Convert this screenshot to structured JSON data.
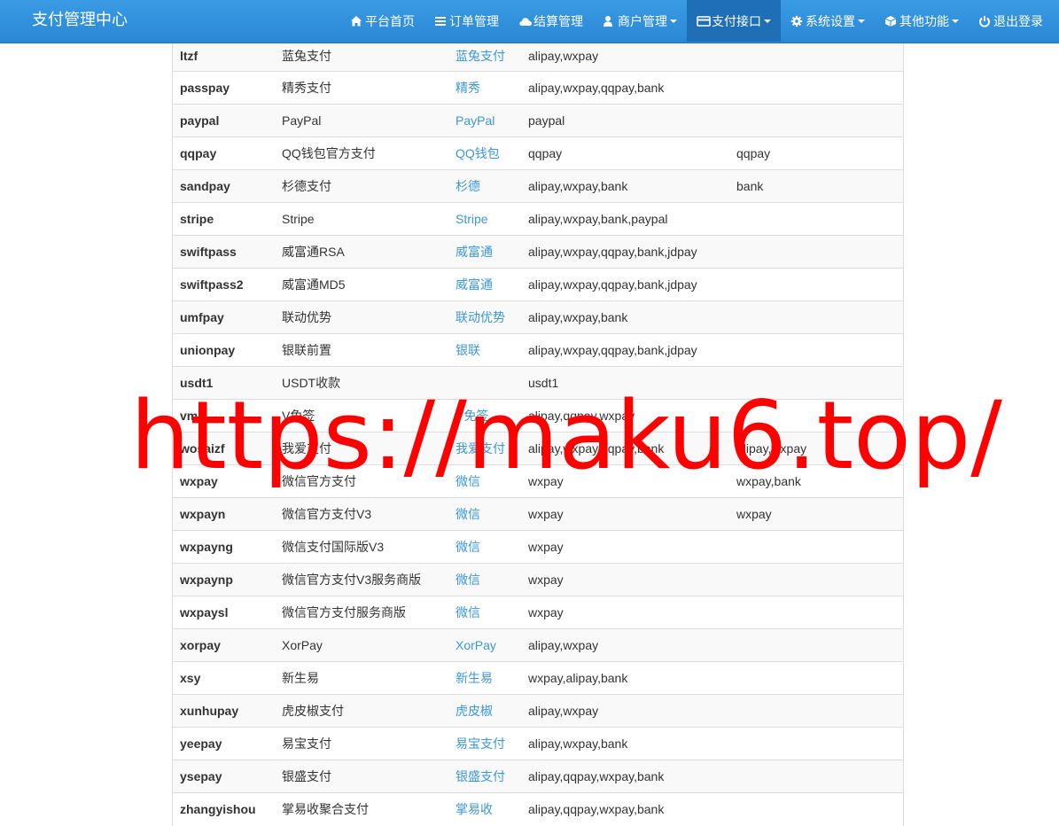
{
  "navbar": {
    "brand": "支付管理中心",
    "items": [
      {
        "label": "平台首页",
        "icon": "home-icon",
        "dropdown": false,
        "active": false
      },
      {
        "label": "订单管理",
        "icon": "list-icon",
        "dropdown": false,
        "active": false
      },
      {
        "label": "结算管理",
        "icon": "cloud-icon",
        "dropdown": false,
        "active": false
      },
      {
        "label": "商户管理",
        "icon": "user-icon",
        "dropdown": true,
        "active": false
      },
      {
        "label": "支付接口",
        "icon": "credit-card-icon",
        "dropdown": true,
        "active": true
      },
      {
        "label": "系统设置",
        "icon": "gear-icon",
        "dropdown": true,
        "active": false
      },
      {
        "label": "其他功能",
        "icon": "cube-icon",
        "dropdown": true,
        "active": false
      },
      {
        "label": "退出登录",
        "icon": "power-icon",
        "dropdown": false,
        "active": false
      }
    ]
  },
  "plugins": [
    {
      "code": "ltzf",
      "name": "蓝兔支付",
      "link": "蓝兔支付",
      "types": "alipay,wxpay",
      "transfer": ""
    },
    {
      "code": "passpay",
      "name": "精秀支付",
      "link": "精秀",
      "types": "alipay,wxpay,qqpay,bank",
      "transfer": ""
    },
    {
      "code": "paypal",
      "name": "PayPal",
      "link": "PayPal",
      "types": "paypal",
      "transfer": ""
    },
    {
      "code": "qqpay",
      "name": "QQ钱包官方支付",
      "link": "QQ钱包",
      "types": "qqpay",
      "transfer": "qqpay"
    },
    {
      "code": "sandpay",
      "name": "杉德支付",
      "link": "杉德",
      "types": "alipay,wxpay,bank",
      "transfer": "bank"
    },
    {
      "code": "stripe",
      "name": "Stripe",
      "link": "Stripe",
      "types": "alipay,wxpay,bank,paypal",
      "transfer": ""
    },
    {
      "code": "swiftpass",
      "name": "威富通RSA",
      "link": "威富通",
      "types": "alipay,wxpay,qqpay,bank,jdpay",
      "transfer": ""
    },
    {
      "code": "swiftpass2",
      "name": "威富通MD5",
      "link": "威富通",
      "types": "alipay,wxpay,qqpay,bank,jdpay",
      "transfer": ""
    },
    {
      "code": "umfpay",
      "name": "联动优势",
      "link": "联动优势",
      "types": "alipay,wxpay,bank",
      "transfer": ""
    },
    {
      "code": "unionpay",
      "name": "银联前置",
      "link": "银联",
      "types": "alipay,wxpay,qqpay,bank,jdpay",
      "transfer": ""
    },
    {
      "code": "usdt1",
      "name": "USDT收款",
      "link": "",
      "types": "usdt1",
      "transfer": ""
    },
    {
      "code": "vmq",
      "name": "V免签",
      "link": "V免签",
      "types": "alipay,qqpay,wxpay",
      "transfer": ""
    },
    {
      "code": "wosaizf",
      "name": "我爱支付",
      "link": "我爱支付",
      "types": "alipay,wxpay,qqpay,bank",
      "transfer": "alipay,wxpay"
    },
    {
      "code": "wxpay",
      "name": "微信官方支付",
      "link": "微信",
      "types": "wxpay",
      "transfer": "wxpay,bank"
    },
    {
      "code": "wxpayn",
      "name": "微信官方支付V3",
      "link": "微信",
      "types": "wxpay",
      "transfer": "wxpay"
    },
    {
      "code": "wxpayng",
      "name": "微信支付国际版V3",
      "link": "微信",
      "types": "wxpay",
      "transfer": ""
    },
    {
      "code": "wxpaynp",
      "name": "微信官方支付V3服务商版",
      "link": "微信",
      "types": "wxpay",
      "transfer": ""
    },
    {
      "code": "wxpaysl",
      "name": "微信官方支付服务商版",
      "link": "微信",
      "types": "wxpay",
      "transfer": ""
    },
    {
      "code": "xorpay",
      "name": "XorPay",
      "link": "XorPay",
      "types": "alipay,wxpay",
      "transfer": ""
    },
    {
      "code": "xsy",
      "name": "新生易",
      "link": "新生易",
      "types": "wxpay,alipay,bank",
      "transfer": ""
    },
    {
      "code": "xunhupay",
      "name": "虎皮椒支付",
      "link": "虎皮椒",
      "types": "alipay,wxpay",
      "transfer": ""
    },
    {
      "code": "yeepay",
      "name": "易宝支付",
      "link": "易宝支付",
      "types": "alipay,wxpay,bank",
      "transfer": ""
    },
    {
      "code": "ysepay",
      "name": "银盛支付",
      "link": "银盛支付",
      "types": "alipay,qqpay,wxpay,bank",
      "transfer": ""
    },
    {
      "code": "zhangyishou",
      "name": "掌易收聚合支付",
      "link": "掌易收",
      "types": "alipay,qqpay,wxpay,bank",
      "transfer": ""
    }
  ],
  "watermark": {
    "text": "https://maku6.top/",
    "color": "#ff0000"
  },
  "colors": {
    "navbar": "#2a87d4",
    "navbar_active": "#1e6fb5",
    "link": "#3c97d6"
  }
}
